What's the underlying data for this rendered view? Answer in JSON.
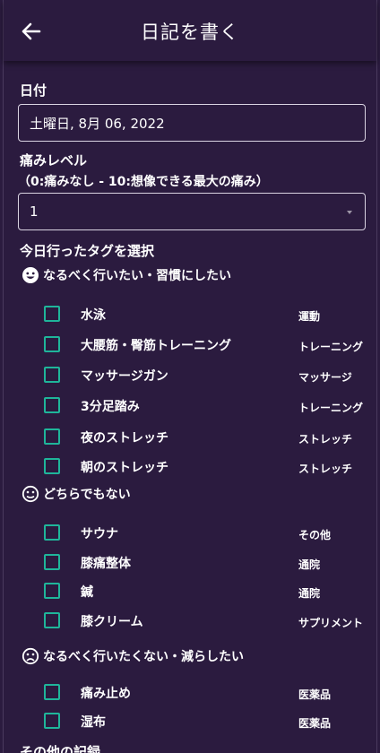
{
  "header": {
    "title": "日記を書く",
    "back_icon": "arrow-left-icon"
  },
  "date": {
    "label": "日付",
    "value": "土曜日, 8月 06, 2022"
  },
  "pain": {
    "label": "痛みレベル",
    "hint": "（0:痛みなし - 10:想像できる最大の痛み）",
    "value": "1"
  },
  "tags": {
    "label": "今日行ったタグを選択",
    "groups": [
      {
        "title": "なるべく行いたい・習慣にしたい",
        "icon": "smile-face-icon",
        "items": [
          {
            "name": "水泳",
            "category": "運動",
            "checked": false
          },
          {
            "name": "大腰筋・臀筋トレーニング",
            "category": "トレーニング",
            "checked": false
          },
          {
            "name": "マッサージガン",
            "category": "マッサージ",
            "checked": false
          },
          {
            "name": "3分足踏み",
            "category": "トレーニング",
            "checked": false
          },
          {
            "name": "夜のストレッチ",
            "category": "ストレッチ",
            "checked": false
          },
          {
            "name": "朝のストレッチ",
            "category": "ストレッチ",
            "checked": false
          }
        ]
      },
      {
        "title": "どちらでもない",
        "icon": "neutral-face-icon",
        "items": [
          {
            "name": "サウナ",
            "category": "その他",
            "checked": false
          },
          {
            "name": "膝痛整体",
            "category": "通院",
            "checked": false
          },
          {
            "name": "鍼",
            "category": "通院",
            "checked": false
          },
          {
            "name": "膝クリーム",
            "category": "サプリメント",
            "checked": false
          }
        ]
      },
      {
        "title": "なるべく行いたくない・減らしたい",
        "icon": "frown-face-icon",
        "items": [
          {
            "name": "痛み止め",
            "category": "医薬品",
            "checked": false
          },
          {
            "name": "湿布",
            "category": "医薬品",
            "checked": false
          }
        ]
      }
    ]
  },
  "other": {
    "label": "その他の記録"
  },
  "colors": {
    "background": "#2b1b3f",
    "checkbox": "#1fb59a",
    "text": "#ffffff"
  }
}
